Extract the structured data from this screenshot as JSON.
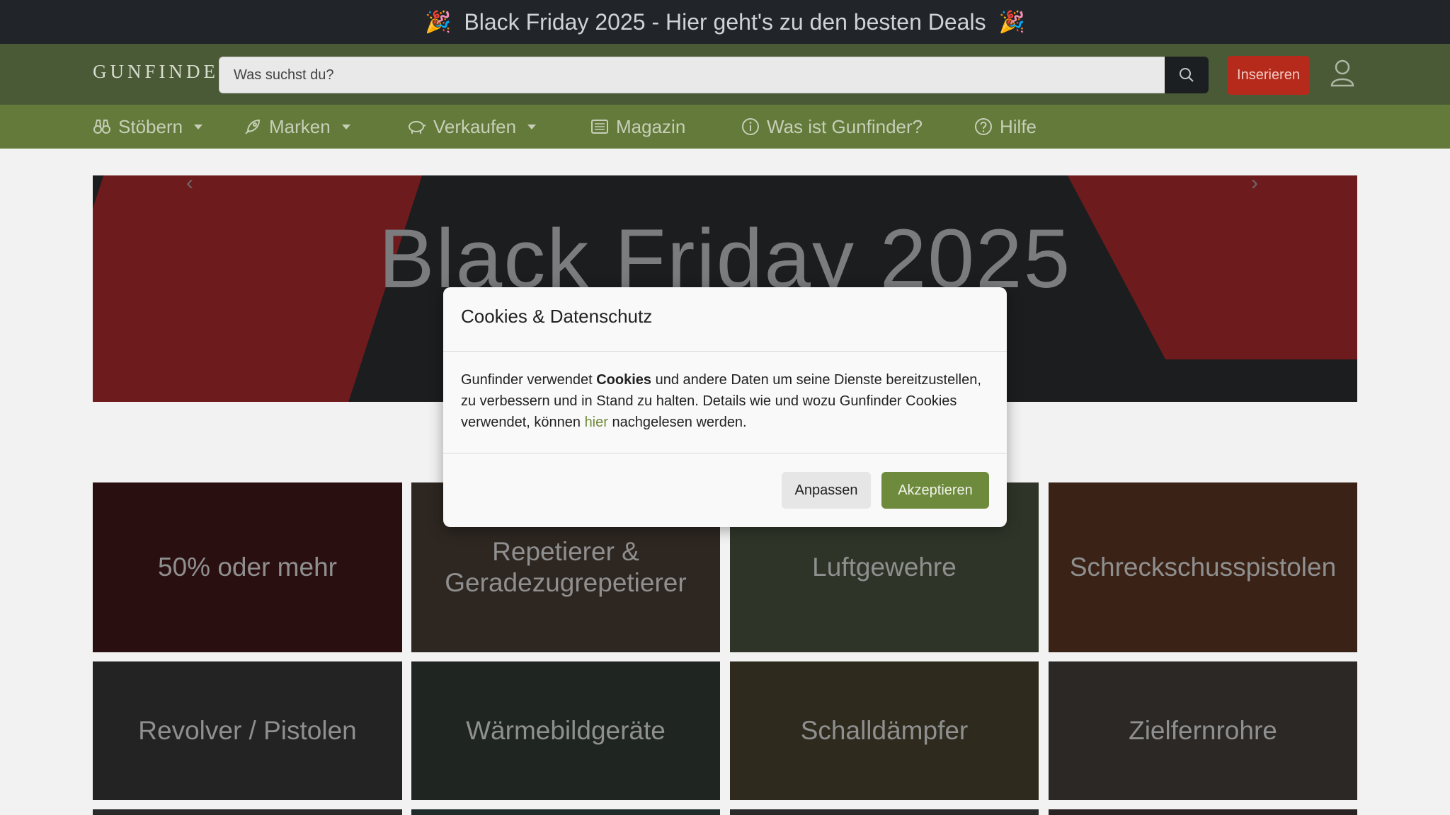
{
  "promo": {
    "emoji": "🎉",
    "text": "Black Friday 2025 - Hier geht's zu den besten Deals"
  },
  "header": {
    "logo": "GUNFINDER",
    "search_placeholder": "Was suchst du?",
    "insert_label": "Inserieren"
  },
  "nav": {
    "items": [
      {
        "label": "Stöbern",
        "icon": "binoculars-icon",
        "dropdown": true
      },
      {
        "label": "Marken",
        "icon": "rocket-icon",
        "dropdown": true
      },
      {
        "label": "Verkaufen",
        "icon": "piggy-bank-icon",
        "dropdown": true
      },
      {
        "label": "Magazin",
        "icon": "newspaper-icon",
        "dropdown": false
      },
      {
        "label": "Was ist Gunfinder?",
        "icon": "info-icon",
        "dropdown": false
      },
      {
        "label": "Hilfe",
        "icon": "question-icon",
        "dropdown": false
      }
    ]
  },
  "hero": {
    "title": "Black Friday 2025"
  },
  "categories": [
    {
      "label": "50% oder mehr"
    },
    {
      "label": "Repetierer & Geradezugrepetierer"
    },
    {
      "label": "Luftgewehre"
    },
    {
      "label": "Schreckschusspistolen"
    },
    {
      "label": "Revolver / Pistolen"
    },
    {
      "label": "Wärmebildgeräte"
    },
    {
      "label": "Schalldämpfer"
    },
    {
      "label": "Zielfernrohre"
    }
  ],
  "cookie_modal": {
    "title": "Cookies & Datenschutz",
    "body_prefix": "Gunfinder verwendet ",
    "body_bold": "Cookies",
    "body_middle": " und andere Daten um seine Dienste bereitzustellen, zu verbessern und in Stand zu halten. Details wie und wozu Gunfinder Cookies verwendet, können ",
    "body_link": "hier",
    "body_suffix": " nachgelesen werden.",
    "adjust_label": "Anpassen",
    "accept_label": "Akzeptieren"
  }
}
